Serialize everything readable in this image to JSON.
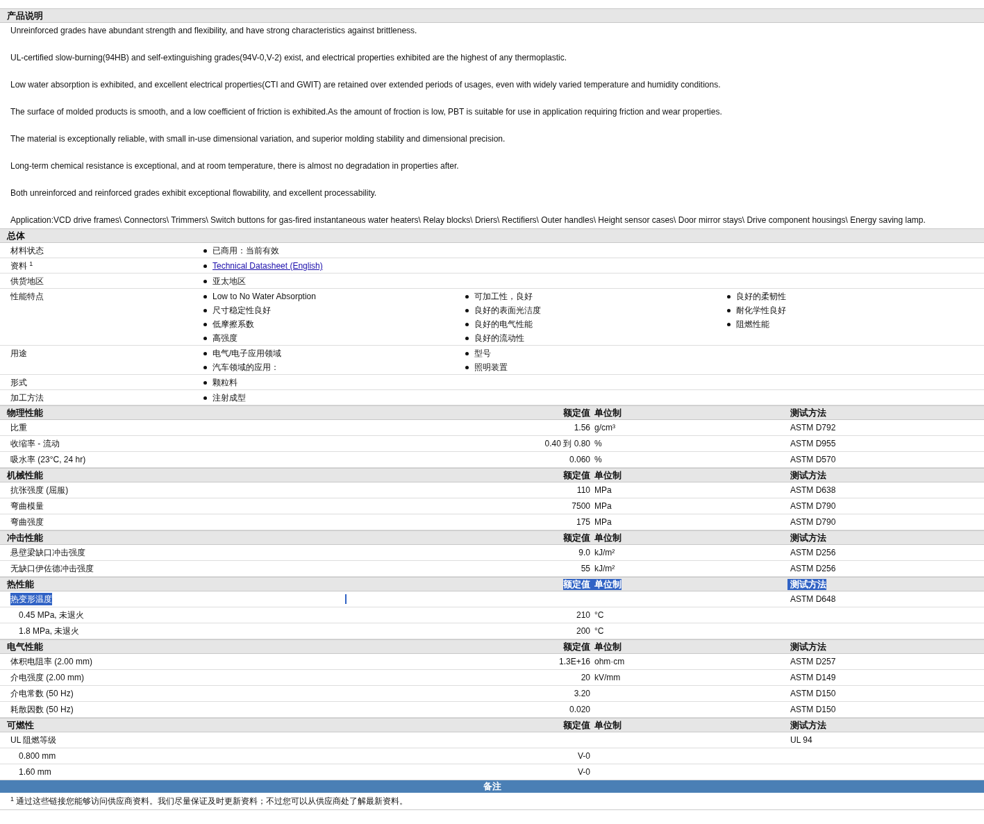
{
  "description": {
    "title": "产品说明",
    "paragraphs": [
      "Unreinforced grades have abundant strength and flexibility, and have strong characteristics against brittleness.",
      "UL-certified slow-burning(94HB) and self-extinguishing grades(94V-0,V-2) exist, and electrical properties exhibited are the highest of any thermoplastic.",
      "Low water absorption is exhibited, and excellent electrical properties(CTI and GWIT) are retained over extended periods of usages, even with widely varied temperature and humidity conditions.",
      "The surface of molded products is smooth, and a low coefficient of friction is exhibited.As the amount of froction is low, PBT is suitable for use in application requiring friction and wear properties.",
      "The material is exceptionally reliable, with small in-use dimensional variation, and superior molding stability and dimensional precision.",
      "Long-term chemical resistance is exceptional, and at room temperature, there is almost no degradation in properties after.",
      "Both unreinforced and reinforced grades exhibit exceptional flowability, and excellent processability.",
      "Application:VCD drive frames\\ Connectors\\ Trimmers\\ Switch buttons for gas-fired instantaneous water heaters\\ Relay blocks\\ Driers\\ Rectifiers\\ Outer handles\\ Height sensor cases\\ Door mirror stays\\ Drive component housings\\ Energy saving lamp."
    ]
  },
  "general": {
    "title": "总体",
    "rows": [
      {
        "label": "材料状态",
        "columns": [
          [
            {
              "kind": "text",
              "text": "已商用：当前有效"
            }
          ]
        ]
      },
      {
        "label": "资料 $^{1}$",
        "columns": [
          [
            {
              "kind": "link",
              "text": "Technical Datasheet (English)"
            }
          ]
        ]
      },
      {
        "label": "供货地区",
        "columns": [
          [
            {
              "kind": "text",
              "text": "亚太地区"
            }
          ]
        ]
      },
      {
        "label": "性能特点",
        "columns": [
          [
            {
              "kind": "text",
              "text": "Low to No Water Absorption"
            },
            {
              "kind": "text",
              "text": "尺寸稳定性良好"
            },
            {
              "kind": "text",
              "text": "低摩擦系数"
            },
            {
              "kind": "text",
              "text": "高强度"
            }
          ],
          [
            {
              "kind": "text",
              "text": "可加工性，良好"
            },
            {
              "kind": "text",
              "text": "良好的表面光洁度"
            },
            {
              "kind": "text",
              "text": "良好的电气性能"
            },
            {
              "kind": "text",
              "text": "良好的流动性"
            }
          ],
          [
            {
              "kind": "text",
              "text": "良好的柔韧性"
            },
            {
              "kind": "text",
              "text": "耐化学性良好"
            },
            {
              "kind": "text",
              "text": "阻燃性能"
            }
          ]
        ]
      },
      {
        "label": "用途",
        "columns": [
          [
            {
              "kind": "text",
              "text": "电气/电子应用领域"
            },
            {
              "kind": "text",
              "text": "汽车领域的应用："
            }
          ],
          [
            {
              "kind": "text",
              "text": "型号"
            },
            {
              "kind": "text",
              "text": "照明装置"
            }
          ]
        ]
      },
      {
        "label": "形式",
        "columns": [
          [
            {
              "kind": "text",
              "text": "颗粒料"
            }
          ]
        ]
      },
      {
        "label": "加工方法",
        "columns": [
          [
            {
              "kind": "text",
              "text": "注射成型"
            }
          ]
        ]
      }
    ]
  },
  "sections": [
    {
      "title": "物理性能",
      "value_header": "额定值",
      "unit_header": "单位制",
      "method_header": "测试方法",
      "selected": false,
      "rows": [
        {
          "kind": "measure",
          "name": "比重",
          "value": "1.56",
          "unit": "g/cm³",
          "method": "ASTM D792",
          "selected": false
        },
        {
          "kind": "measure",
          "name": "收缩率 - 流动",
          "value": "0.40 到 0.80",
          "unit": "%",
          "method": "ASTM D955",
          "selected": false
        },
        {
          "kind": "measure",
          "name": "吸水率 (23°C, 24 hr)",
          "value": "0.060",
          "unit": "%",
          "method": "ASTM D570",
          "selected": false
        }
      ]
    },
    {
      "title": "机械性能",
      "value_header": "额定值",
      "unit_header": "单位制",
      "method_header": "测试方法",
      "selected": false,
      "rows": [
        {
          "kind": "measure",
          "name": "抗张强度 (屈服)",
          "value": "110",
          "unit": "MPa",
          "method": "ASTM D638",
          "selected": false
        },
        {
          "kind": "measure",
          "name": "弯曲模量",
          "value": "7500",
          "unit": "MPa",
          "method": "ASTM D790",
          "selected": false
        },
        {
          "kind": "measure",
          "name": "弯曲强度",
          "value": "175",
          "unit": "MPa",
          "method": "ASTM D790",
          "selected": false
        }
      ]
    },
    {
      "title": "冲击性能",
      "value_header": "额定值",
      "unit_header": "单位制",
      "method_header": "测试方法",
      "selected": false,
      "rows": [
        {
          "kind": "measure",
          "name": "悬壁梁缺口冲击强度",
          "value": "9.0",
          "unit": "kJ/m²",
          "method": "ASTM D256",
          "selected": false
        },
        {
          "kind": "measure",
          "name": "无缺口伊佐德冲击强度",
          "value": "55",
          "unit": "kJ/m²",
          "method": "ASTM D256",
          "selected": false
        }
      ]
    },
    {
      "title": "热性能",
      "value_header": "额定值",
      "unit_header": "单位制",
      "method_header": "测试方法",
      "selected": true,
      "rows": [
        {
          "kind": "measure",
          "name": "热变形温度",
          "method": "ASTM D648",
          "selected": true,
          "children": [
            {
              "kind": "measure",
              "name": "0.45 MPa, 未退火",
              "value": "210",
              "unit": "°C",
              "selected": false
            },
            {
              "kind": "measure",
              "name": "1.8 MPa, 未退火",
              "value": "200",
              "unit": "°C",
              "selected": false
            }
          ]
        }
      ]
    },
    {
      "title": "电气性能",
      "value_header": "额定值",
      "unit_header": "单位制",
      "method_header": "测试方法",
      "selected": false,
      "rows": [
        {
          "kind": "measure",
          "name": "体积电阻率 (2.00 mm)",
          "value": "1.3E+16",
          "unit": "ohm·cm",
          "method": "ASTM D257",
          "selected": false
        },
        {
          "kind": "measure",
          "name": "介电强度 (2.00 mm)",
          "value": "20",
          "unit": "kV/mm",
          "method": "ASTM D149",
          "selected": false
        },
        {
          "kind": "measure",
          "name": "介电常数 (50 Hz)",
          "value": "3.20",
          "method": "ASTM D150",
          "selected": false
        },
        {
          "kind": "measure",
          "name": "耗散因数 (50 Hz)",
          "value": "0.020",
          "method": "ASTM D150",
          "selected": false
        }
      ]
    },
    {
      "title": "可燃性",
      "value_header": "额定值",
      "unit_header": "单位制",
      "method_header": "测试方法",
      "selected": false,
      "rows": [
        {
          "kind": "measure",
          "name": "UL 阻燃等级",
          "method": "UL 94",
          "selected": false,
          "children": [
            {
              "kind": "rating",
              "name": "0.800 mm",
              "value": "V-0",
              "selected": false
            },
            {
              "kind": "rating",
              "name": "1.60 mm",
              "value": "V-0",
              "selected": false
            }
          ]
        }
      ]
    }
  ],
  "notes": {
    "title": "备注",
    "footnote": "$^{1}$ 通过这些链接您能够访问供应商资料。我们尽量保证及时更新资料；不过您可以从供应商处了解最新资料。"
  }
}
